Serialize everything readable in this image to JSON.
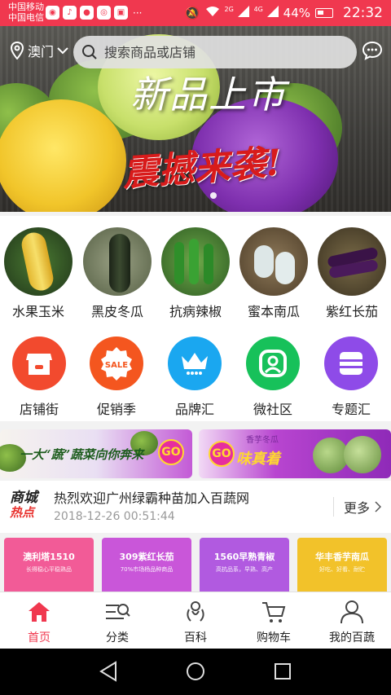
{
  "status_bar": {
    "carrier1": "中国移动",
    "carrier2": "中国电信",
    "net1": "2G",
    "net2": "4G",
    "battery": "44%",
    "time": "22:32",
    "dots": "···"
  },
  "header": {
    "location": "澳门",
    "search_placeholder": "搜索商品或店铺"
  },
  "banner": {
    "title": "新品上市",
    "subtitle": "震撼来袭!"
  },
  "categories": [
    {
      "label": "水果玉米"
    },
    {
      "label": "黑皮冬瓜"
    },
    {
      "label": "抗病辣椒"
    },
    {
      "label": "蜜本南瓜"
    },
    {
      "label": "紫红长茄"
    }
  ],
  "nav": [
    {
      "label": "店铺街",
      "color": "#f24a2e"
    },
    {
      "label": "促销季",
      "color": "#f4561f"
    },
    {
      "label": "品牌汇",
      "color": "#1aa7f0"
    },
    {
      "label": "微社区",
      "color": "#17c15a"
    },
    {
      "label": "专题汇",
      "color": "#8e4be8"
    }
  ],
  "promos": {
    "left_text": "一大“蔬”蔬菜向你奔来",
    "right_small": "香芋冬瓜",
    "right_text": "味真着",
    "go": "GO",
    "sale": "SALE"
  },
  "news": {
    "logo_line1": "商城",
    "logo_line2": "热点",
    "title": "热烈欢迎广州绿霸种苗加入百蔬网",
    "date": "2018-12-26 00:51:44",
    "more": "更多"
  },
  "products": [
    {
      "title": "澳利塔1510",
      "sub": "长得稳心平稳熟品",
      "color": "#f25b97"
    },
    {
      "title": "309紫红长茄",
      "sub": "70%市场杨品种商品",
      "color": "#c956d9"
    },
    {
      "title": "1560早熟青椒",
      "sub": "高抗品系，早熟、高产",
      "color": "#b15ae0"
    },
    {
      "title": "华丰香芋南瓜",
      "sub": "好吃、好看、耐贮",
      "color": "#f2c22a"
    }
  ],
  "tabs": [
    {
      "label": "首页",
      "active": true
    },
    {
      "label": "分类",
      "active": false
    },
    {
      "label": "百科",
      "active": false
    },
    {
      "label": "购物车",
      "active": false
    },
    {
      "label": "我的百蔬",
      "active": false
    }
  ],
  "colors": {
    "accent": "#f0384f",
    "status_bar": "#f0384f"
  }
}
